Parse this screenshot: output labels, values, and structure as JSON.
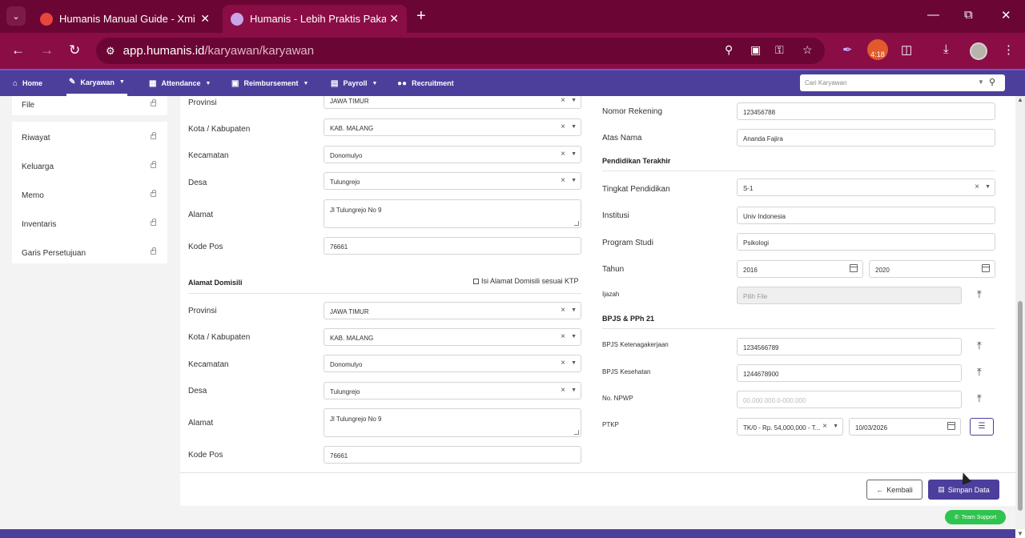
{
  "browser": {
    "tabs": [
      {
        "title": "Humanis Manual Guide - Xmind",
        "active": false
      },
      {
        "title": "Humanis - Lebih Praktis Pakai Humanis",
        "active": true
      }
    ],
    "url_host": "app.humanis.id",
    "url_path": "/karyawan/karyawan",
    "extension_badge": "4:18",
    "colors": {
      "frame": "#6b0634",
      "toolbar": "#8a0d46"
    }
  },
  "app_nav": {
    "items": [
      "Home",
      "Karyawan",
      "Attendance",
      "Reimbursement",
      "Payroll",
      "Recruitment"
    ],
    "search_placeholder": "Cari Karyawan",
    "accent": "#4c3f9c"
  },
  "sidebar": {
    "items": [
      "File",
      "Riwayat",
      "Keluarga",
      "Memo",
      "Inventaris",
      "Garis Persetujuan"
    ]
  },
  "ktp_address": {
    "provinsi_label": "Provinsi",
    "provinsi": "JAWA TIMUR",
    "kota_label": "Kota / Kabupaten",
    "kota": "KAB. MALANG",
    "kecamatan_label": "Kecamatan",
    "kecamatan": "Donomulyo",
    "desa_label": "Desa",
    "desa": "Tulungrejo",
    "alamat_label": "Alamat",
    "alamat": "Jl Tulungrejo No 9",
    "kodepos_label": "Kode Pos",
    "kodepos": "76661"
  },
  "domicile": {
    "heading": "Alamat Domisili",
    "checkbox_label": "Isi Alamat Domisili sesuai KTP",
    "provinsi_label": "Provinsi",
    "provinsi": "JAWA TIMUR",
    "kota_label": "Kota / Kabupaten",
    "kota": "KAB. MALANG",
    "kecamatan_label": "Kecamatan",
    "kecamatan": "Donomulyo",
    "desa_label": "Desa",
    "desa": "Tulungrejo",
    "alamat_label": "Alamat",
    "alamat": "Jl Tulungrejo No 9",
    "kodepos_label": "Kode Pos",
    "kodepos": "76661"
  },
  "bank": {
    "rekening_label": "Nomor Rekening",
    "rekening": "123456788",
    "atasnama_label": "Atas Nama",
    "atasnama": "Ananda Fajira"
  },
  "education": {
    "heading": "Pendidikan Terakhir",
    "tingkat_label": "Tingkat Pendidikan",
    "tingkat": "S-1",
    "institusi_label": "Institusi",
    "institusi": "Univ Indonesia",
    "prodi_label": "Program Studi",
    "prodi": "Psikologi",
    "tahun_label": "Tahun",
    "tahun_start": "2016",
    "tahun_end": "2020",
    "ijazah_label": "Ijazah",
    "ijazah_placeholder": "Pilih File"
  },
  "bpjs": {
    "heading": "BPJS & PPh 21",
    "tk_label": "BPJS Ketenagakerjaan",
    "tk": "1234566789",
    "kes_label": "BPJS Kesehatan",
    "kes": "1244678900",
    "npwp_label": "No. NPWP",
    "npwp_placeholder": "00.000.000.0-000.000",
    "ptkp_label": "PTKP",
    "ptkp": "TK/0 - Rp. 54,000,000 - T...",
    "ptkp_date": "10/03/2026"
  },
  "actions": {
    "back": "Kembali",
    "save": "Simpan Data",
    "support": "Team Support"
  }
}
